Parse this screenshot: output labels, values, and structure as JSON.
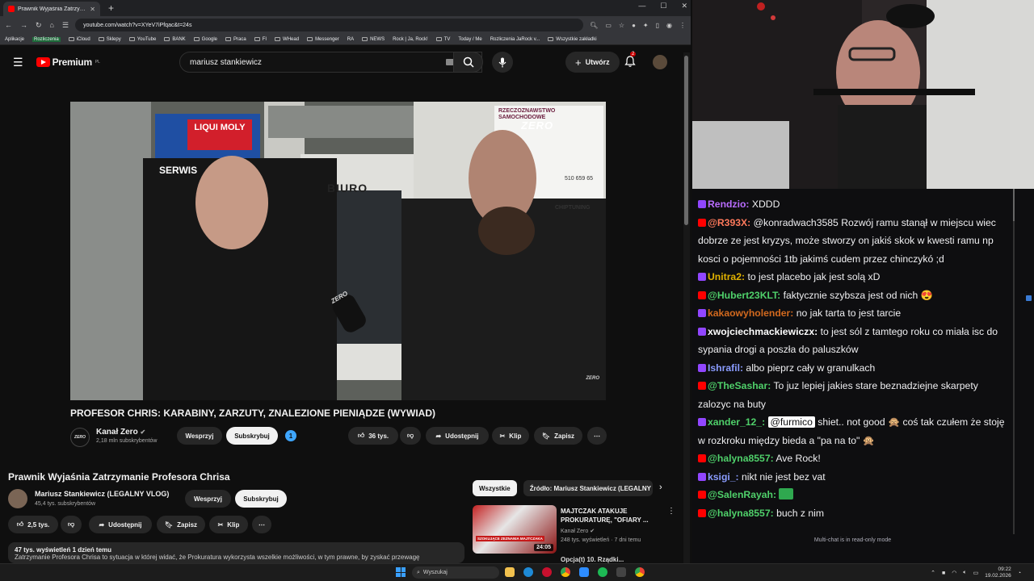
{
  "browser": {
    "tab_title": "Prawnik Wyjaśnia Zatrzymanie Profesora Chrisa",
    "url": "youtube.com/watch?v=XYeV7iPfqac&t=24s",
    "bookmarks": [
      "Aplikacje",
      "Rozliczenia",
      "iCloud",
      "Sklepy",
      "YouTube",
      "BANK",
      "Google",
      "Praca",
      "FI",
      "WHead",
      "Messenger",
      "RA",
      "NEWS",
      "Rock | Ja, Rock!",
      "TV",
      "Today / Me",
      "Rozliczenia JaRock v...",
      "Wszystkie zakładki"
    ]
  },
  "youtube": {
    "logo_text": "Premium",
    "logo_region": "PL",
    "search_value": "mariusz stankiewicz",
    "create_label": "Utwórz",
    "notifications_count": "2",
    "video": {
      "title": "PROFESOR CHRIS: KARABINY, ZARZUTY, ZNALEZIONE PIENIĄDZE (WYWIAD)",
      "channel": "Kanał Zero",
      "channel_logo": "ZERO",
      "subs": "2,18 mln subskrybentów",
      "support": "Wesprzyj",
      "subscribe": "Subskrybuj",
      "badge": "1",
      "likes": "36 tys.",
      "share": "Udostępnij",
      "clip": "Klip",
      "save": "Zapisz",
      "player_sign_biuro": "BIURO",
      "player_sign_liqui": "LIQUI MOLY",
      "player_sign_serwis": "SERWIS",
      "player_sign_rzecz": "RZECZOZNAWSTWO SAMOCHODOWE",
      "player_logo": "ZERO",
      "player_phone": "510 659 65",
      "player_tuning": "CHIPTUNING",
      "player_mic": "ZERO",
      "player_corner": "ZERO"
    },
    "video2": {
      "title": "Prawnik Wyjaśnia Zatrzymanie Profesora Chrisa",
      "channel": "Mariusz Stankiewicz (LEGALNY VLOG)",
      "subs": "45,4 tys. subskrybentów",
      "support": "Wesprzyj",
      "subscribe": "Subskrybuj",
      "likes": "2,5 tys.",
      "share": "Udostępnij",
      "save": "Zapisz",
      "clip": "Klip",
      "desc_meta": "47 tys. wyświetleń  1 dzień temu",
      "desc_text": "Zatrzymanie Profesora Chrisa to sytuacja w której widać, że Prokuratura wykorzysta wszelkie możliwości, w tym prawne, by zyskać przewagę"
    },
    "recs": {
      "chips": [
        "Wszystkie",
        "Źródło: Mariusz Stankiewicz (LEGALNY VLOG)"
      ],
      "item": {
        "title": "MAJTCZAK ATAKUJE PROKURATURĘ, \"OFIARY ...",
        "channel": "Kanał Zero",
        "stats": "248 tys. wyświetleń · 7 dni temu",
        "duration": "24:05",
        "thumb_caption": "SZOKUJĄCE ZEZNANIA MAJTCZAKA"
      },
      "next_title": "Opcja(t) 10. Rządki..."
    }
  },
  "chat": {
    "messages": [
      {
        "platform": "twitch",
        "user": "Rendzio:",
        "color": "#b96cff",
        "text": "XDDD"
      },
      {
        "platform": "youtube",
        "user": "@R393X:",
        "color": "#ff7a5c",
        "text": "@konradwach3585 Rozwój ramu stanął w miejscu wiec dobrze ze jest kryzys, może stworzy on jakiś skok w kwesti ramu np kosci o pojemności 1tb jakimś cudem przez chinczykó ;d"
      },
      {
        "platform": "twitch",
        "user": "Unitra2:",
        "color": "#e0b100",
        "text": "to jest placebo jak jest solą xD"
      },
      {
        "platform": "youtube",
        "user": "@Hubert23KLT:",
        "color": "#4fd06a",
        "text": "faktycznie szybsza jest od nich 😍"
      },
      {
        "platform": "twitch",
        "user": "kakaowyholender:",
        "color": "#d2691e",
        "text": "no jak tarta to jest tarcie"
      },
      {
        "platform": "twitch",
        "user": "xwojciechmackiewiczx:",
        "color": "#ffffff",
        "text": "to jest sól z tamtego roku co miała isc do sypania drogi a poszła do paluszków"
      },
      {
        "platform": "twitch",
        "user": "Ishrafil:",
        "color": "#8a9cff",
        "text": "albo pieprz cały w granulkach"
      },
      {
        "platform": "youtube",
        "user": "@TheSashar:",
        "color": "#4fd06a",
        "text": "To juz lepiej jakies stare beznadziejne skarpety zalozyc na buty"
      },
      {
        "platform": "twitch",
        "user": "xander_12_:",
        "color": "#4fd06a",
        "mention": "@furmico",
        "text": "shiet.. not good 🙊 coś tak czułem że stoję w rozkroku między bieda a \"pa na to\" 🙊"
      },
      {
        "platform": "youtube",
        "user": "@halyna8557:",
        "color": "#4fd06a",
        "text": "Ave Rock!"
      },
      {
        "platform": "twitch",
        "user": "ksigi_:",
        "color": "#8a9cff",
        "text": "nikt nie jest bez vat"
      },
      {
        "platform": "youtube",
        "user": "@SalenRayah:",
        "color": "#4fd06a",
        "text": ""
      },
      {
        "platform": "youtube",
        "user": "@halyna8557:",
        "color": "#4fd06a",
        "text": "buch z nim"
      }
    ],
    "footer": "Multi-chat is in read-only mode"
  },
  "taskbar": {
    "search_placeholder": "Wyszukaj",
    "time": "09:22",
    "date": "19.02.2026"
  }
}
